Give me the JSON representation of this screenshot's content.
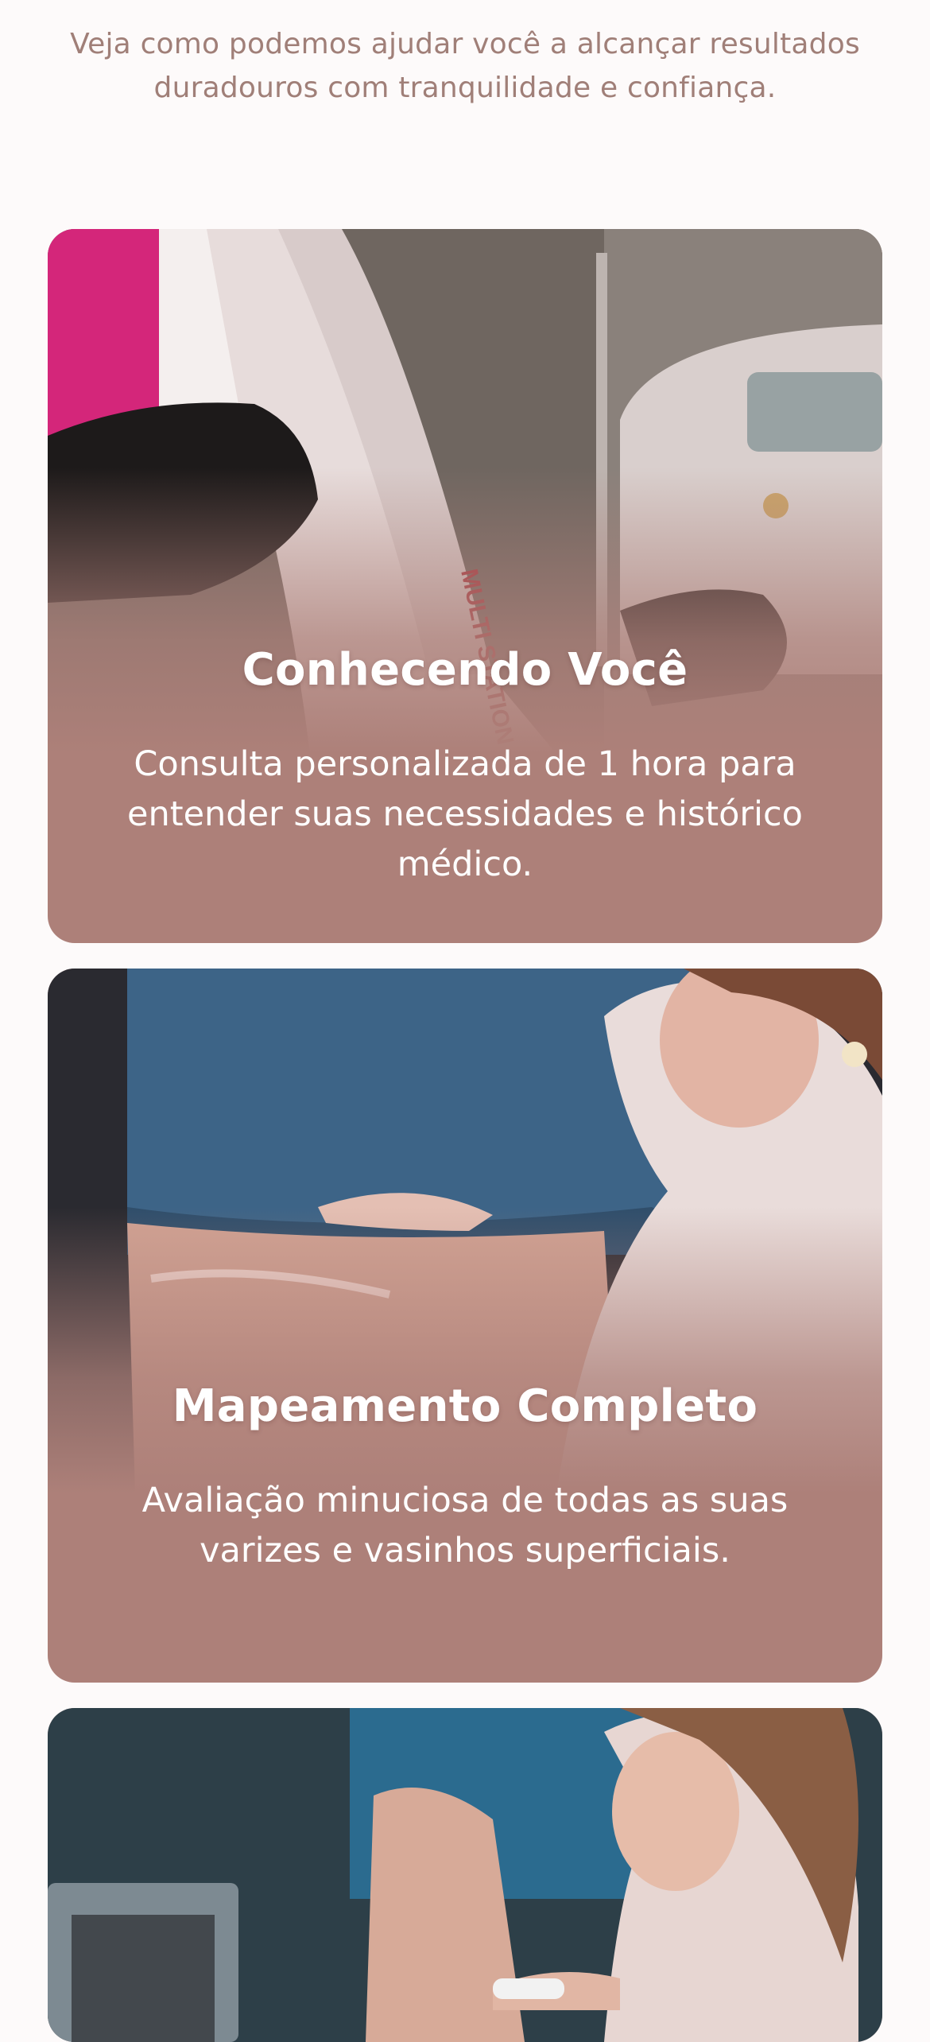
{
  "intro": {
    "text": "Veja como podemos ajudar você a alcançar resultados duradouros com tranquilidade e confiança."
  },
  "cards": [
    {
      "title": "Conhecendo Você",
      "description": "Consulta personalizada de 1 hora para entender suas necessidades e histórico médico.",
      "device_label": "MULTI STATION"
    },
    {
      "title": "Mapeamento Completo",
      "description": "Avaliação minuciosa de todas as suas varizes e vasinhos superficiais."
    },
    {
      "title": "",
      "description": ""
    }
  ],
  "colors": {
    "accent": "#ad8079",
    "intro_text": "#a07f78",
    "background": "#fdfafa"
  }
}
